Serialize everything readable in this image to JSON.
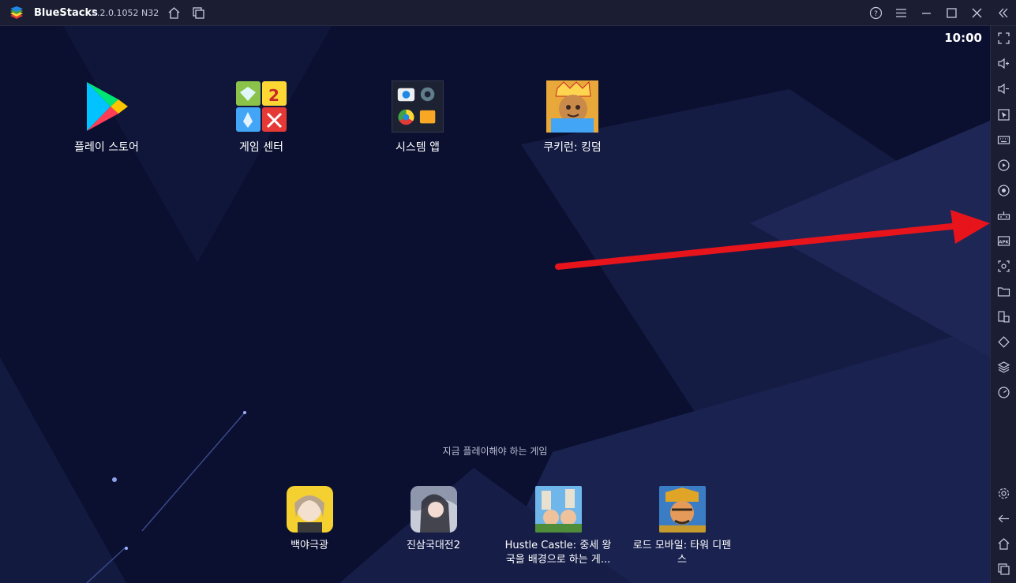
{
  "titlebar": {
    "app_name": "BlueStacks",
    "version": "5.2.0.1052 N32"
  },
  "clock": "10:00",
  "home_apps": [
    {
      "label": "플레이 스토어",
      "icon": "play-store-icon"
    },
    {
      "label": "게임 센터",
      "icon": "game-center-icon"
    },
    {
      "label": "시스템 앱",
      "icon": "system-apps-icon"
    },
    {
      "label": "쿠키런: 킹덤",
      "icon": "cookie-run-kingdom-icon"
    }
  ],
  "recommended": {
    "title": "지금 플레이해야 하는 게임",
    "games": [
      {
        "label": "백야극광",
        "icon": "game-thumbnail"
      },
      {
        "label": "진삼국대전2",
        "icon": "game-thumbnail"
      },
      {
        "label_line1": "Hustle Castle: 중세 왕",
        "label_line2": "국을 배경으로 하는 게...",
        "icon": "game-thumbnail"
      },
      {
        "label_line1": "로드 모바일: 타워 디펜",
        "label_line2": "스",
        "icon": "game-thumbnail"
      }
    ]
  },
  "sidebar_icons": [
    "fullscreen-icon",
    "volume-up-icon",
    "volume-down-icon",
    "cursor-icon",
    "keyboard-icon",
    "macro-play-icon",
    "record-icon",
    "game-controls-icon",
    "install-apk-icon",
    "screenshot-icon",
    "folder-icon",
    "multi-instance-icon",
    "rotate-icon",
    "layers-icon",
    "performance-icon",
    "settings-icon",
    "back-icon",
    "home-icon",
    "recent-apps-icon"
  ],
  "colors": {
    "background": "#0b1030",
    "chrome": "#1b1e33",
    "annotation_arrow": "#e8141c"
  }
}
